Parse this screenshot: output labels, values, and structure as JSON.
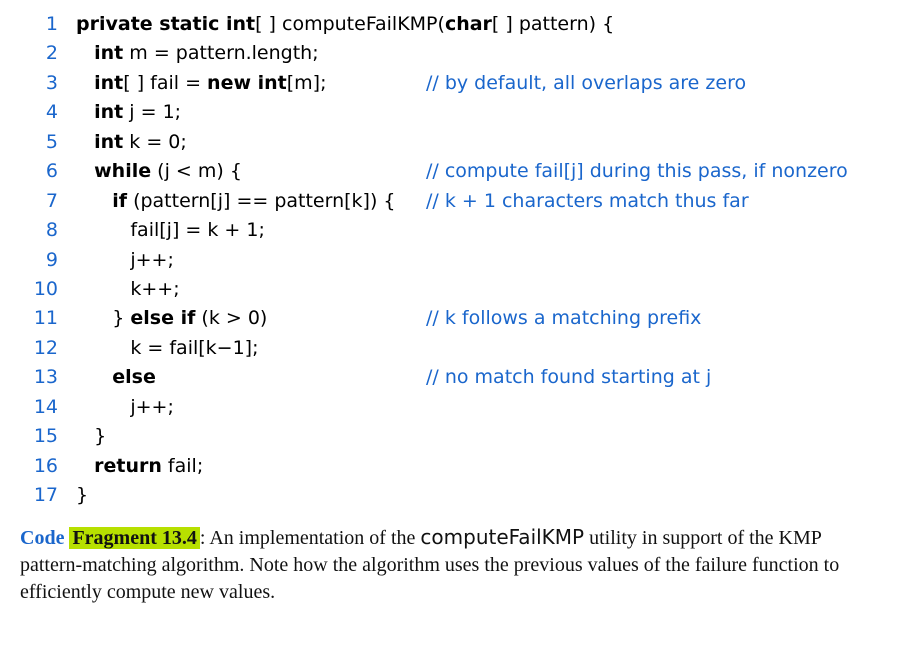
{
  "code": {
    "lines": [
      {
        "n": "1",
        "indent": 0,
        "segs": [
          [
            "kw",
            "private static int"
          ],
          [
            "",
            "[ ] computeFailKMP("
          ],
          [
            "kw",
            "char"
          ],
          [
            "",
            "[ ] pattern) {"
          ]
        ],
        "comment": ""
      },
      {
        "n": "2",
        "indent": 1,
        "segs": [
          [
            "kw",
            "int"
          ],
          [
            "",
            " m = pattern.length;"
          ]
        ],
        "comment": ""
      },
      {
        "n": "3",
        "indent": 1,
        "segs": [
          [
            "kw",
            "int"
          ],
          [
            "",
            "[ ] fail = "
          ],
          [
            "kw",
            "new int"
          ],
          [
            "",
            "[m];"
          ]
        ],
        "comment": "// by default, all overlaps are zero"
      },
      {
        "n": "4",
        "indent": 1,
        "segs": [
          [
            "kw",
            "int"
          ],
          [
            "",
            " j = 1;"
          ]
        ],
        "comment": ""
      },
      {
        "n": "5",
        "indent": 1,
        "segs": [
          [
            "kw",
            "int"
          ],
          [
            "",
            " k = 0;"
          ]
        ],
        "comment": ""
      },
      {
        "n": "6",
        "indent": 1,
        "segs": [
          [
            "kw",
            "while"
          ],
          [
            "",
            " (j < m) {"
          ]
        ],
        "comment": "// compute fail[j] during this pass, if nonzero"
      },
      {
        "n": "7",
        "indent": 2,
        "segs": [
          [
            "kw",
            "if"
          ],
          [
            "",
            " (pattern[j] == pattern[k]) {"
          ]
        ],
        "comment": "// k + 1 characters match thus far"
      },
      {
        "n": "8",
        "indent": 3,
        "segs": [
          [
            "",
            "fail[j] = k + 1;"
          ]
        ],
        "comment": ""
      },
      {
        "n": "9",
        "indent": 3,
        "segs": [
          [
            "",
            "j++;"
          ]
        ],
        "comment": ""
      },
      {
        "n": "10",
        "indent": 3,
        "segs": [
          [
            "",
            "k++;"
          ]
        ],
        "comment": ""
      },
      {
        "n": "11",
        "indent": 2,
        "segs": [
          [
            "",
            "} "
          ],
          [
            "kw",
            "else if"
          ],
          [
            "",
            " (k > 0)"
          ]
        ],
        "comment": "// k follows a matching prefix"
      },
      {
        "n": "12",
        "indent": 3,
        "segs": [
          [
            "",
            "k = fail[k−1];"
          ]
        ],
        "comment": ""
      },
      {
        "n": "13",
        "indent": 2,
        "segs": [
          [
            "kw",
            "else"
          ]
        ],
        "comment": "// no match found starting at j"
      },
      {
        "n": "14",
        "indent": 3,
        "segs": [
          [
            "",
            "j++;"
          ]
        ],
        "comment": ""
      },
      {
        "n": "15",
        "indent": 1,
        "segs": [
          [
            "",
            "}"
          ]
        ],
        "comment": ""
      },
      {
        "n": "16",
        "indent": 1,
        "segs": [
          [
            "kw",
            "return"
          ],
          [
            "",
            " fail;"
          ]
        ],
        "comment": ""
      },
      {
        "n": "17",
        "indent": 0,
        "segs": [
          [
            "",
            "}"
          ]
        ],
        "comment": ""
      }
    ]
  },
  "caption": {
    "label": "Code ",
    "fragnum": "Fragment 13.4",
    "colon": ": ",
    "text1": "An implementation of the ",
    "sans": "computeFailKMP",
    "text2": " utility in support of the KMP pattern-matching algorithm. Note how the algorithm uses the previous values of the failure function to efficiently compute new values."
  }
}
